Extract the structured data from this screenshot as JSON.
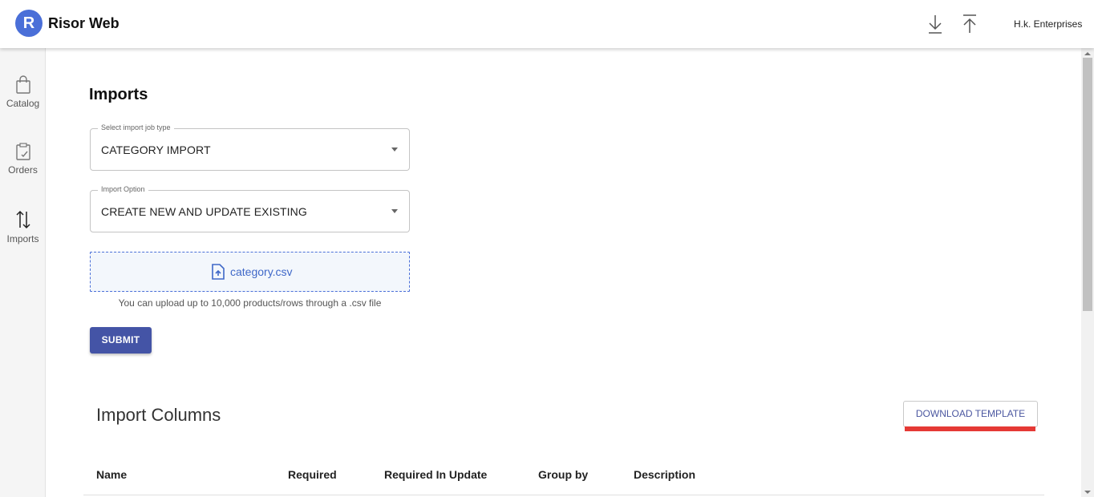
{
  "header": {
    "logo_letter": "R",
    "brand": "Risor Web",
    "download_icon": "arrow-down-to-line-icon",
    "upload_icon": "arrow-up-from-line-icon",
    "organization": "H.k. Enterprises"
  },
  "sidebar": {
    "items": [
      {
        "label": "Catalog",
        "icon": "shopping-bag-icon"
      },
      {
        "label": "Orders",
        "icon": "clipboard-check-icon"
      },
      {
        "label": "Imports",
        "icon": "swap-vertical-icon"
      }
    ]
  },
  "main": {
    "title": "Imports",
    "job_type": {
      "legend": "Select import job type",
      "value": "CATEGORY IMPORT"
    },
    "import_option": {
      "legend": "Import Option",
      "value": "CREATE NEW AND UPDATE EXISTING"
    },
    "upload": {
      "file_name": "category.csv",
      "icon": "file-upload-icon",
      "hint": "You can upload up to 10,000 products/rows through a .csv file"
    },
    "submit_label": "SUBMIT"
  },
  "columns_section": {
    "title": "Import Columns",
    "download_label": "DOWNLOAD TEMPLATE",
    "headers": [
      "Name",
      "Required",
      "Required In Update",
      "Group by",
      "Description"
    ]
  },
  "colors": {
    "primary": "#4454a6",
    "accent_blue": "#4a6fd8",
    "highlight_red": "#e53935"
  }
}
